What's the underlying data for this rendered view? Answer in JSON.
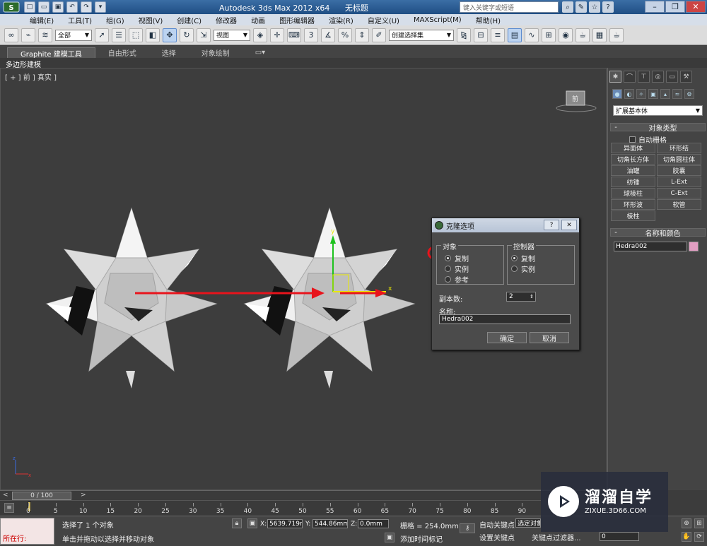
{
  "title_bar": {
    "app_title": "Autodesk 3ds Max  2012 x64",
    "doc_title": "无标题",
    "search_placeholder": "键入关键字或短语"
  },
  "menu": {
    "items": [
      "编辑(E)",
      "工具(T)",
      "组(G)",
      "视图(V)",
      "创建(C)",
      "修改器",
      "动画",
      "图形编辑器",
      "渲染(R)",
      "自定义(U)",
      "MAXScript(M)",
      "帮助(H)"
    ]
  },
  "toolbar": {
    "selection_filter": "全部",
    "ref_coord": "视图",
    "named_selection": "创建选择集",
    "snap_label": "3",
    "angle_label": "%"
  },
  "ribbon": {
    "tabs": [
      "Graphite 建模工具",
      "自由形式",
      "选择",
      "对象绘制"
    ],
    "sub_label": "多边形建模"
  },
  "viewport": {
    "label": "[ + ] 前 ] 真实 ]",
    "viewcube_label": "前"
  },
  "clone_dialog": {
    "title": "克隆选项",
    "help": "?",
    "close": "✕",
    "object_group": "对象",
    "object_options": [
      "复制",
      "实例",
      "参考"
    ],
    "controller_group": "控制器",
    "controller_options": [
      "复制",
      "实例"
    ],
    "copies_label": "副本数:",
    "copies_value": "2",
    "name_label": "名称:",
    "name_value": "Hedra002",
    "ok": "确定",
    "cancel": "取消"
  },
  "command_panel": {
    "category": "扩展基本体",
    "object_type_title": "对象类型",
    "autogrid": "自动栅格",
    "buttons": [
      "异面体",
      "环形结",
      "切角长方体",
      "切角圆柱体",
      "油罐",
      "胶囊",
      "纺锤",
      "L-Ext",
      "球棱柱",
      "C-Ext",
      "环形波",
      "软管",
      "棱柱"
    ],
    "name_color_title": "名称和颜色",
    "object_name": "Hedra002",
    "object_color": "#e29ec2"
  },
  "timeline": {
    "frame_display": "0 / 100",
    "ticks": [
      "0",
      "5",
      "10",
      "15",
      "20",
      "25",
      "30",
      "35",
      "40",
      "45",
      "50",
      "55",
      "60",
      "65",
      "70",
      "75",
      "80",
      "85",
      "90"
    ]
  },
  "status": {
    "listener_label": "所在行:",
    "selection_status": "选择了 1 个对象",
    "prompt": "单击并拖动以选择并移动对象",
    "x_label": "X:",
    "x_value": "5639.719n",
    "y_label": "Y:",
    "y_value": "544.86mm",
    "z_label": "Z:",
    "z_value": "0.0mm",
    "grid": "栅格 = 254.0mm",
    "add_time_tag": "添加时间标记",
    "auto_key": "自动关键点",
    "selected": "选定对象",
    "set_key": "设置关键点",
    "key_filters": "关键点过滤器...",
    "frame_value": "0"
  },
  "watermark": {
    "title": "溜溜自学",
    "url": "ZIXUE.3D66.COM"
  },
  "colors": {
    "annotation_red": "#e8141c",
    "viewport_bg": "#3d3d3d",
    "titlebar": "#2b5a92"
  }
}
